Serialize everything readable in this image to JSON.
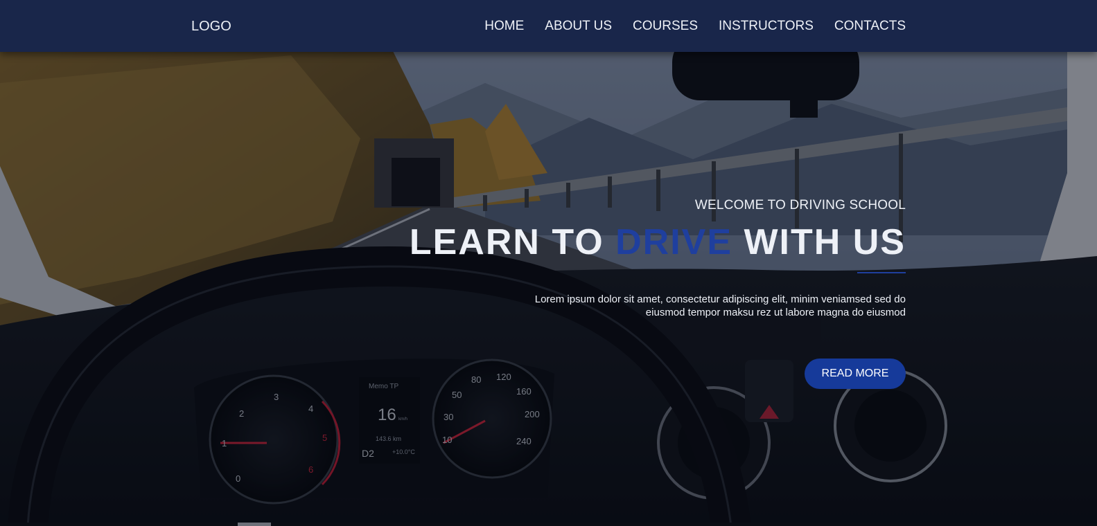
{
  "header": {
    "logo": "LOGO",
    "nav": [
      "HOME",
      "ABOUT US",
      "COURSES",
      "INSTRUCTORS",
      "CONTACTS"
    ]
  },
  "hero": {
    "welcome": "WELCOME TO DRIVING SCHOOL",
    "headline_part1": "LEARN TO ",
    "headline_accent": "DRIVE",
    "headline_part2": " WITH US",
    "description_line1": "Lorem ipsum dolor sit amet, consectetur adipiscing elit, minim veniamsed sed do",
    "description_line2": "eiusmod tempor maksu rez ut labore magna do eiusmod",
    "button": "READ MORE",
    "dashboard": {
      "display_title": "Memo TP",
      "speed": "16",
      "speed_unit": "km/h",
      "distance": "143.6 km",
      "gear": "D2",
      "temperature": "+10.0°C"
    }
  },
  "colors": {
    "header_bg": "#19264a",
    "accent": "#1f3f9e",
    "button_bg": "#163a9a",
    "text": "#eef1f7"
  }
}
